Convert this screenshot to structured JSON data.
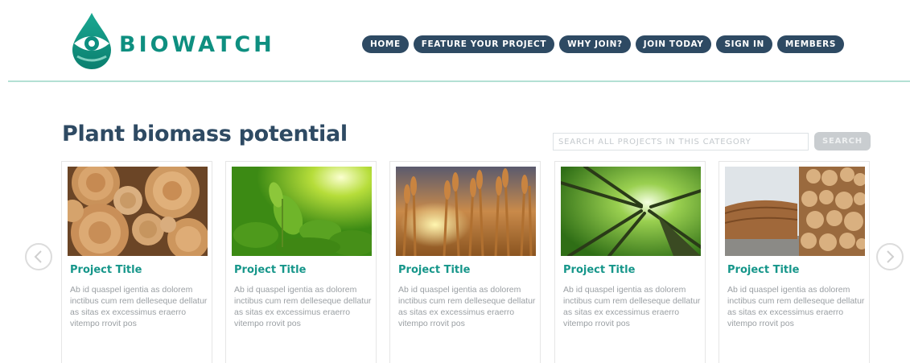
{
  "brand": {
    "name": "BIOWATCH",
    "color": "#0e8f80",
    "logo_icon": "water-drop-eye-icon"
  },
  "nav": {
    "items": [
      {
        "label": "HOME"
      },
      {
        "label": "FEATURE YOUR PROJECT"
      },
      {
        "label": "WHY JOIN?"
      },
      {
        "label": "JOIN TODAY"
      },
      {
        "label": "SIGN IN"
      },
      {
        "label": "MEMBERS"
      }
    ],
    "color": "#2e4a63"
  },
  "page": {
    "title": "Plant biomass potential"
  },
  "search": {
    "placeholder": "SEARCH ALL PROJECTS IN THIS CATEGORY",
    "button_label": "SEARCH"
  },
  "carousel": {
    "prev_icon": "chevron-left-icon",
    "next_icon": "chevron-right-icon",
    "cards": [
      {
        "title": "Project Title",
        "description": "Ab id quaspel igentia as dolorem inctibus cum rem delleseque dellatur as sitas ex excessimus eraerro vitempo rrovit pos",
        "image": "log-ends-photo"
      },
      {
        "title": "Project Title",
        "description": "Ab id quaspel igentia as dolorem inctibus cum rem delleseque dellatur as sitas ex excessimus eraerro vitempo rrovit pos",
        "image": "green-tea-leaves-photo"
      },
      {
        "title": "Project Title",
        "description": "Ab id quaspel igentia as dolorem inctibus cum rem delleseque dellatur as sitas ex excessimus eraerro vitempo rrovit pos",
        "image": "wheat-field-sunset-photo"
      },
      {
        "title": "Project Title",
        "description": "Ab id quaspel igentia as dolorem inctibus cum rem delleseque dellatur as sitas ex excessimus eraerro vitempo rrovit pos",
        "image": "forest-canopy-photo"
      },
      {
        "title": "Project Title",
        "description": "Ab id quaspel igentia as dolorem inctibus cum rem delleseque dellatur as sitas ex excessimus eraerro vitempo rrovit pos",
        "image": "timber-stack-photo"
      }
    ]
  }
}
